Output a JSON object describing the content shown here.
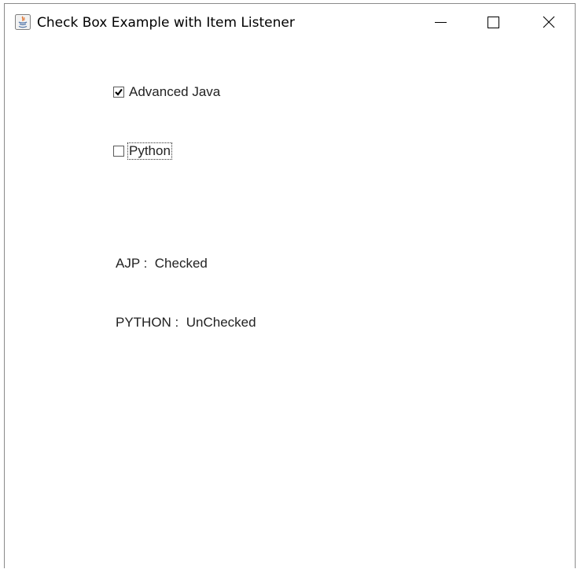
{
  "window": {
    "title": "Check Box Example with Item Listener",
    "icon": "java-icon"
  },
  "checkboxes": [
    {
      "label": "Advanced Java",
      "checked": true
    },
    {
      "label": "Python",
      "checked": false,
      "focused": true
    }
  ],
  "status": {
    "ajp": "AJP :  Checked",
    "python": "PYTHON :  UnChecked"
  }
}
